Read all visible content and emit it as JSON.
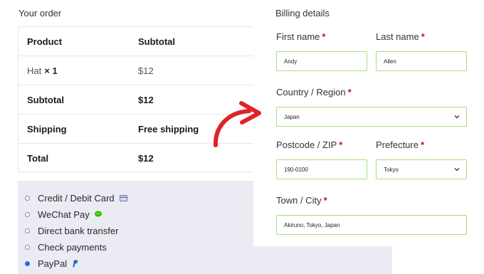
{
  "order": {
    "title": "Your order",
    "header": {
      "product": "Product",
      "subtotal": "Subtotal"
    },
    "item": {
      "name": "Hat",
      "qty": "× 1",
      "price": "$12"
    },
    "subtotal": {
      "label": "Subtotal",
      "value": "$12"
    },
    "shipping": {
      "label": "Shipping",
      "value": "Free shipping"
    },
    "total": {
      "label": "Total",
      "value": "$12"
    }
  },
  "payment": {
    "methods": [
      {
        "label": "Credit / Debit Card",
        "icon": "credit-card-icon",
        "selected": false
      },
      {
        "label": "WeChat Pay",
        "icon": "wechat-icon",
        "selected": false
      },
      {
        "label": "Direct bank transfer",
        "icon": "",
        "selected": false
      },
      {
        "label": "Check payments",
        "icon": "",
        "selected": false
      },
      {
        "label": "PayPal",
        "icon": "paypal-icon",
        "selected": true
      }
    ]
  },
  "billing": {
    "title": "Billing details",
    "first_name": {
      "label": "First name",
      "value": "Andy"
    },
    "last_name": {
      "label": "Last name",
      "value": "Allen"
    },
    "country": {
      "label": "Country / Region",
      "value": "Japan"
    },
    "postcode": {
      "label": "Postcode / ZIP",
      "value": "190-0100"
    },
    "prefecture": {
      "label": "Prefecture",
      "value": "Tokyo"
    },
    "town": {
      "label": "Town / City",
      "value": "Akiruno, Tokyo, Japan"
    },
    "required_mark": "*"
  },
  "colors": {
    "accent_border": "#a7e07f",
    "required": "#c8102e",
    "arrow": "#e0222a",
    "payment_bg": "#ebebf3",
    "radio_selected": "#2b6ce0"
  }
}
